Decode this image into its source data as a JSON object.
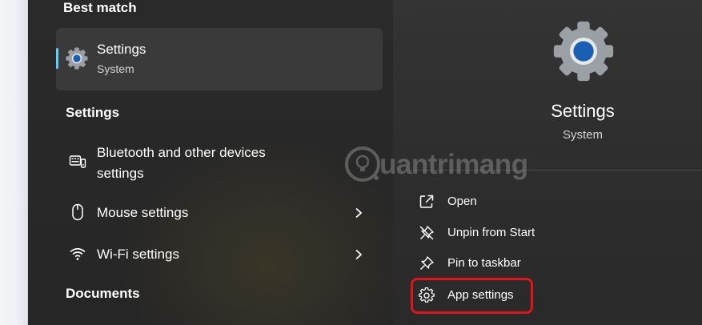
{
  "search_results": {
    "best_match_heading": "Best match",
    "best_match": {
      "title": "Settings",
      "subtitle": "System",
      "icon": "gear-icon"
    },
    "settings_heading": "Settings",
    "settings_items": [
      {
        "label_line1": "Bluetooth and other devices",
        "label_line2": "settings",
        "icon": "bluetooth-devices-icon",
        "has_chevron": false
      },
      {
        "label": "Mouse settings",
        "icon": "mouse-icon",
        "has_chevron": true
      },
      {
        "label": "Wi-Fi settings",
        "icon": "wifi-icon",
        "has_chevron": true
      }
    ],
    "documents_heading": "Documents"
  },
  "detail": {
    "title": "Settings",
    "subtitle": "System",
    "actions": [
      {
        "label": "Open",
        "icon": "open-external-icon"
      },
      {
        "label": "Unpin from Start",
        "icon": "unpin-icon"
      },
      {
        "label": "Pin to taskbar",
        "icon": "pin-icon"
      },
      {
        "label": "App settings",
        "icon": "gear-outline-icon",
        "highlighted": true
      }
    ]
  },
  "watermark": {
    "text": "uantrimang"
  },
  "colors": {
    "accent": "#60cdff",
    "gear_center": "#1a5fb4",
    "highlight_border": "#e0141b",
    "panel_bg": "#2a2a2a",
    "selected_bg": "#3a3a3a"
  }
}
